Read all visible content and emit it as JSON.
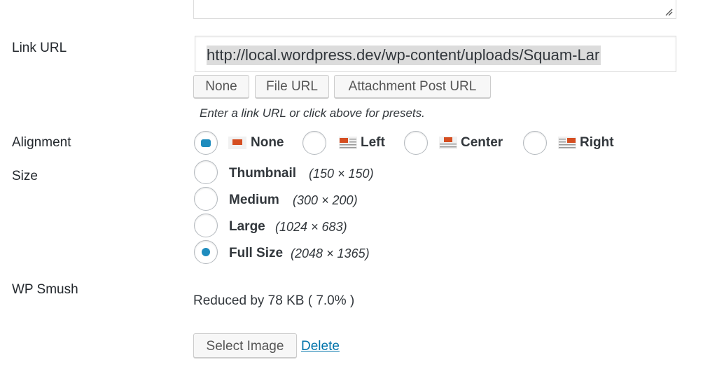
{
  "link_url": {
    "label": "Link URL",
    "value": "http://local.wordpress.dev/wp-content/uploads/Squam-Lar",
    "buttons": [
      "None",
      "File URL",
      "Attachment Post URL"
    ],
    "hint": "Enter a link URL or click above for presets."
  },
  "alignment": {
    "label": "Alignment",
    "selected": "None",
    "options": [
      {
        "label": "None",
        "icon": "align-none-icon"
      },
      {
        "label": "Left",
        "icon": "align-left-icon"
      },
      {
        "label": "Center",
        "icon": "align-center-icon"
      },
      {
        "label": "Right",
        "icon": "align-right-icon"
      }
    ]
  },
  "size": {
    "label": "Size",
    "selected": "Full Size",
    "options": [
      {
        "name": "Thumbnail",
        "dims": "(150 × 150)"
      },
      {
        "name": "Medium",
        "dims": "(300 × 200)"
      },
      {
        "name": "Large",
        "dims": "(1024 × 683)"
      },
      {
        "name": "Full Size",
        "dims": "(2048 × 1365)"
      }
    ]
  },
  "wp_smush": {
    "label": "WP Smush",
    "status": "Reduced by 78 KB ( 7.0% )",
    "select_button": "Select Image",
    "delete_link": "Delete"
  },
  "colors": {
    "accent": "#1e8cbe",
    "link": "#0073aa",
    "align_icon_red": "#d54e21"
  }
}
